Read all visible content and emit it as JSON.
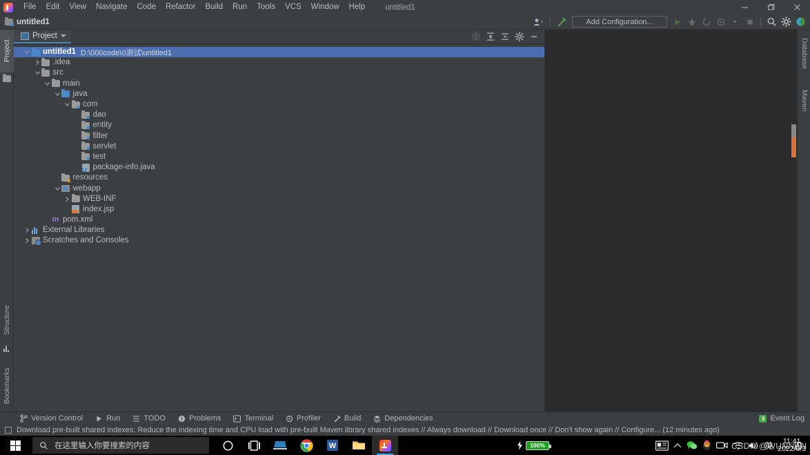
{
  "window": {
    "title": "untitled1",
    "menu": [
      {
        "label": "File",
        "mnemonic": "F"
      },
      {
        "label": "Edit",
        "mnemonic": "E"
      },
      {
        "label": "View",
        "mnemonic": "V"
      },
      {
        "label": "Navigate",
        "mnemonic": "N"
      },
      {
        "label": "Code",
        "mnemonic": "C"
      },
      {
        "label": "Refactor",
        "mnemonic": "R"
      },
      {
        "label": "Build",
        "mnemonic": "B"
      },
      {
        "label": "Run",
        "mnemonic": "u"
      },
      {
        "label": "Tools",
        "mnemonic": "T"
      },
      {
        "label": "VCS",
        "mnemonic": "S"
      },
      {
        "label": "Window",
        "mnemonic": "W"
      },
      {
        "label": "Help",
        "mnemonic": "H"
      }
    ],
    "controls": {
      "minimize": "minimize-icon",
      "maximize": "restore-icon",
      "close": "close-icon"
    }
  },
  "navbar": {
    "breadcrumb": "untitled1",
    "run_config": "Add Configuration...",
    "icons": {
      "user": "user-dropdown-icon",
      "hammer": "build-hammer-icon",
      "run": "run-icon",
      "debug": "debug-icon",
      "coverage": "run-with-coverage-icon",
      "profile": "profile-icon",
      "profile_caret": "chevron-down-icon",
      "stop": "stop-icon",
      "search": "search-everywhere-icon",
      "settings": "gear-icon",
      "updates": "ide-update-icon"
    }
  },
  "left_stripe": {
    "top_tabs": [
      {
        "label": "Project",
        "icon": "project-icon",
        "active": true
      }
    ],
    "bottom_tabs": [
      {
        "label": "Structure",
        "icon": "structure-icon"
      },
      {
        "label": "Bookmarks",
        "icon": "bookmarks-icon"
      }
    ]
  },
  "right_stripe": {
    "tabs": [
      {
        "label": "Database",
        "icon": "database-icon"
      },
      {
        "label": "Maven",
        "icon": "maven-icon"
      }
    ]
  },
  "project_tool_window": {
    "tab_label": "Project",
    "tab_icon": "project-icon",
    "actions": [
      {
        "name": "select-opened-file-icon",
        "enabled": false
      },
      {
        "name": "expand-all-icon",
        "enabled": true
      },
      {
        "name": "collapse-all-icon",
        "enabled": true
      },
      {
        "name": "gear-icon",
        "enabled": true
      },
      {
        "name": "hide-icon",
        "enabled": true
      }
    ],
    "tree": [
      {
        "indent": 0,
        "arrow": "down",
        "icon": "module-folder-icon",
        "label": "untitled1",
        "bold": true,
        "sub": "D:\\000code\\0测试\\untitled1",
        "selected": true
      },
      {
        "indent": 1,
        "arrow": "right",
        "icon": "folder-icon",
        "label": ".idea",
        "bold": false,
        "sub": "",
        "selected": false
      },
      {
        "indent": 1,
        "arrow": "down",
        "icon": "folder-icon",
        "label": "src",
        "bold": false,
        "sub": "",
        "selected": false
      },
      {
        "indent": 2,
        "arrow": "down",
        "icon": "folder-icon",
        "label": "main",
        "bold": false,
        "sub": "",
        "selected": false
      },
      {
        "indent": 3,
        "arrow": "down",
        "icon": "source-folder-icon",
        "label": "java",
        "bold": false,
        "sub": "",
        "selected": false
      },
      {
        "indent": 4,
        "arrow": "down",
        "icon": "package-icon",
        "label": "com",
        "bold": false,
        "sub": "",
        "selected": false
      },
      {
        "indent": 5,
        "arrow": "none",
        "icon": "package-icon",
        "label": "dao",
        "bold": false,
        "sub": "",
        "selected": false
      },
      {
        "indent": 5,
        "arrow": "none",
        "icon": "package-icon",
        "label": "entity",
        "bold": false,
        "sub": "",
        "selected": false
      },
      {
        "indent": 5,
        "arrow": "none",
        "icon": "package-icon",
        "label": "filter",
        "bold": false,
        "sub": "",
        "selected": false
      },
      {
        "indent": 5,
        "arrow": "none",
        "icon": "package-icon",
        "label": "servlet",
        "bold": false,
        "sub": "",
        "selected": false
      },
      {
        "indent": 5,
        "arrow": "none",
        "icon": "package-icon",
        "label": "test",
        "bold": false,
        "sub": "",
        "selected": false
      },
      {
        "indent": 5,
        "arrow": "none",
        "icon": "java-file-icon",
        "label": "package-info.java",
        "bold": false,
        "sub": "",
        "selected": false
      },
      {
        "indent": 3,
        "arrow": "none",
        "icon": "resources-folder-icon",
        "label": "resources",
        "bold": false,
        "sub": "",
        "selected": false
      },
      {
        "indent": 3,
        "arrow": "down",
        "icon": "webapp-folder-icon",
        "label": "webapp",
        "bold": false,
        "sub": "",
        "selected": false
      },
      {
        "indent": 4,
        "arrow": "right",
        "icon": "folder-icon",
        "label": "WEB-INF",
        "bold": false,
        "sub": "",
        "selected": false
      },
      {
        "indent": 4,
        "arrow": "none",
        "icon": "jsp-file-icon",
        "label": "index.jsp",
        "bold": false,
        "sub": "",
        "selected": false
      },
      {
        "indent": 2,
        "arrow": "none",
        "icon": "maven-pom-icon",
        "label": "pom.xml",
        "bold": false,
        "sub": "",
        "selected": false
      },
      {
        "indent": 0,
        "arrow": "right",
        "icon": "external-libraries-icon",
        "label": "External Libraries",
        "bold": false,
        "sub": "",
        "selected": false
      },
      {
        "indent": 0,
        "arrow": "right",
        "icon": "scratches-icon",
        "label": "Scratches and Consoles",
        "bold": false,
        "sub": "",
        "selected": false
      }
    ]
  },
  "bottom_bar": {
    "items": [
      {
        "label": "Version Control",
        "icon": "branch-icon"
      },
      {
        "label": "Run",
        "icon": "run-icon"
      },
      {
        "label": "TODO",
        "icon": "todo-icon"
      },
      {
        "label": "Problems",
        "icon": "problems-icon"
      },
      {
        "label": "Terminal",
        "icon": "terminal-icon"
      },
      {
        "label": "Profiler",
        "icon": "profiler-icon"
      },
      {
        "label": "Build",
        "icon": "build-hammer-icon"
      },
      {
        "label": "Dependencies",
        "icon": "dependencies-icon"
      }
    ],
    "event_log": {
      "label": "Event Log",
      "badge": "3",
      "icon": "event-log-icon"
    }
  },
  "status_bar": {
    "icon": "notification-icon",
    "message": "Download pre-built shared indexes: Reduce the indexing time and CPU load with pre-built Maven library shared indexes // Always download // Download once // Don't show again // Configure... (12 minutes ago)"
  },
  "taskbar": {
    "start": "windows-start-icon",
    "search_placeholder": "在这里输入你要搜索的内容",
    "search_icon": "search-icon",
    "pinned": [
      {
        "name": "cortana-icon"
      },
      {
        "name": "task-view-icon"
      },
      {
        "name": "remote-desktop-icon"
      },
      {
        "name": "chrome-icon"
      },
      {
        "name": "word-icon"
      },
      {
        "name": "file-explorer-icon"
      },
      {
        "name": "intellij-idea-icon",
        "active": true
      }
    ],
    "tray": {
      "battery_percent": "100%",
      "battery_icon": "battery-charging-icon",
      "news_icon": "news-and-interests-icon",
      "overflow_icon": "chevron-up-icon",
      "wechat_icon": "wechat-icon",
      "qq_icon": "qq-icon",
      "camera_icon": "camera-icon",
      "wifi_icon": "wifi-icon",
      "volume_icon": "volume-icon",
      "ime_icon": "ime-chinese-icon",
      "time": "11:41",
      "date": "2022/6/3"
    },
    "watermark": "CSDN @WUNNAN"
  },
  "colors": {
    "panel": "#3c3f41",
    "editor": "#2b2b2b",
    "selection": "#4b6eaf",
    "accent": "#4a88c7",
    "text": "#bbbbbb",
    "muted": "#8c8c8c",
    "green": "#49a346",
    "orange": "#d9713c"
  }
}
